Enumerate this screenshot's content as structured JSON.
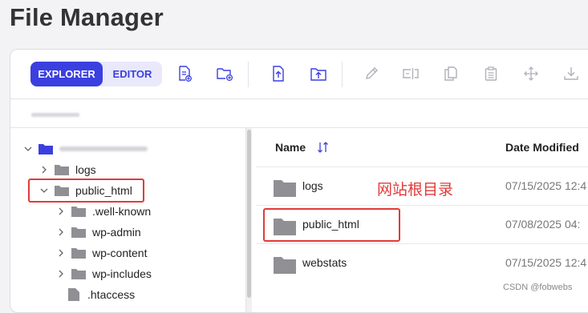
{
  "page": {
    "title": "File Manager"
  },
  "toolbar": {
    "modes": [
      {
        "label": "EXPLORER",
        "active": true
      },
      {
        "label": "EDITOR",
        "active": false
      }
    ],
    "icons": [
      "new-file-icon",
      "new-folder-icon",
      "upload-file-icon",
      "upload-folder-icon",
      "edit-icon",
      "rename-icon",
      "copy-icon",
      "paste-icon",
      "move-icon",
      "download-icon"
    ],
    "accent": "#3b3fe0"
  },
  "tree": {
    "items": [
      {
        "label": "logs",
        "type": "folder",
        "level": 1
      },
      {
        "label": "public_html",
        "type": "folder",
        "level": 1,
        "expanded": true
      },
      {
        "label": ".well-known",
        "type": "folder",
        "level": 2
      },
      {
        "label": "wp-admin",
        "type": "folder",
        "level": 2
      },
      {
        "label": "wp-content",
        "type": "folder",
        "level": 2
      },
      {
        "label": "wp-includes",
        "type": "folder",
        "level": 2
      },
      {
        "label": ".htaccess",
        "type": "file",
        "level": 2
      }
    ]
  },
  "list": {
    "columns": {
      "name": "Name",
      "date": "Date Modified"
    },
    "rows": [
      {
        "name": "logs",
        "date": "07/15/2025 12:4"
      },
      {
        "name": "public_html",
        "date": "07/08/2025 04:"
      },
      {
        "name": "webstats",
        "date": "07/15/2025 12:4"
      }
    ]
  },
  "annotation": {
    "text": "网站根目录",
    "color": "#e23a3a"
  },
  "watermark": "CSDN @fobwebs"
}
